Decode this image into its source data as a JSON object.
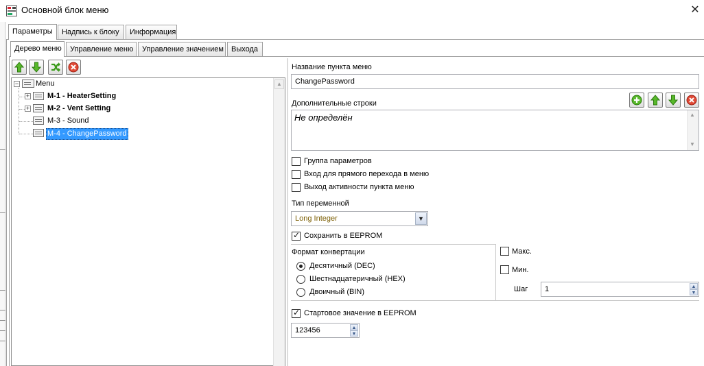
{
  "window": {
    "title": "Основной блок меню",
    "close_glyph": "✕",
    "app_icon": "app-icon"
  },
  "main_tabs": [
    {
      "label": "Параметры",
      "active": true
    },
    {
      "label": "Надпись к блоку",
      "active": false
    },
    {
      "label": "Информация",
      "active": false
    }
  ],
  "sub_tabs": [
    {
      "label": "Дерево меню",
      "active": true
    },
    {
      "label": "Управление меню",
      "active": false
    },
    {
      "label": "Управление значением",
      "active": false
    },
    {
      "label": "Выхода",
      "active": false
    }
  ],
  "tree_toolbar": [
    {
      "name": "move-up-icon"
    },
    {
      "name": "move-down-icon"
    },
    {
      "name": "shuffle-icon"
    },
    {
      "name": "delete-icon"
    }
  ],
  "tree": {
    "root": "Menu",
    "items": [
      {
        "label": "M-1 - HeaterSetting",
        "bold": true,
        "expandable": true,
        "selected": false
      },
      {
        "label": "M-2 - Vent Setting",
        "bold": true,
        "expandable": true,
        "selected": false
      },
      {
        "label": "M-3 - Sound",
        "bold": false,
        "expandable": false,
        "selected": false
      },
      {
        "label": "M-4 - ChangePassword",
        "bold": false,
        "expandable": false,
        "selected": true
      }
    ]
  },
  "form": {
    "name_label": "Название пункта меню",
    "name_value": "ChangePassword",
    "extra_lines_label": "Дополнительные строки",
    "extra_lines_value": "Не определён",
    "extra_toolbar": [
      {
        "name": "add-icon"
      },
      {
        "name": "move-up-icon"
      },
      {
        "name": "move-down-icon"
      },
      {
        "name": "delete-icon"
      }
    ],
    "checkboxes": [
      {
        "label": "Группа параметров",
        "checked": false
      },
      {
        "label": "Вход для прямого перехода в меню",
        "checked": false
      },
      {
        "label": "Выход активности пункта меню",
        "checked": false
      }
    ],
    "var_type_label": "Тип переменной",
    "var_type_value": "Long Integer",
    "save_eeprom_label": "Сохранить в EEPROM",
    "save_eeprom_checked": true,
    "format_label": "Формат конвертации",
    "formats": [
      {
        "label": "Десятичный (DEC)",
        "selected": true
      },
      {
        "label": "Шестнадцатеричный (HEX)",
        "selected": false
      },
      {
        "label": "Двоичный (BIN)",
        "selected": false
      }
    ],
    "max_label": "Макс.",
    "max_checked": false,
    "min_label": "Мин.",
    "min_checked": false,
    "step_label": "Шаг",
    "step_value": "1",
    "start_value_label": "Стартовое значение в EEPROM",
    "start_value_checked": true,
    "start_value": "123456"
  },
  "colors": {
    "selection": "#3399ff",
    "arrow_green": "#3a9a1a",
    "delete_red": "#d83a2a",
    "select_text": "#7a5c00"
  }
}
